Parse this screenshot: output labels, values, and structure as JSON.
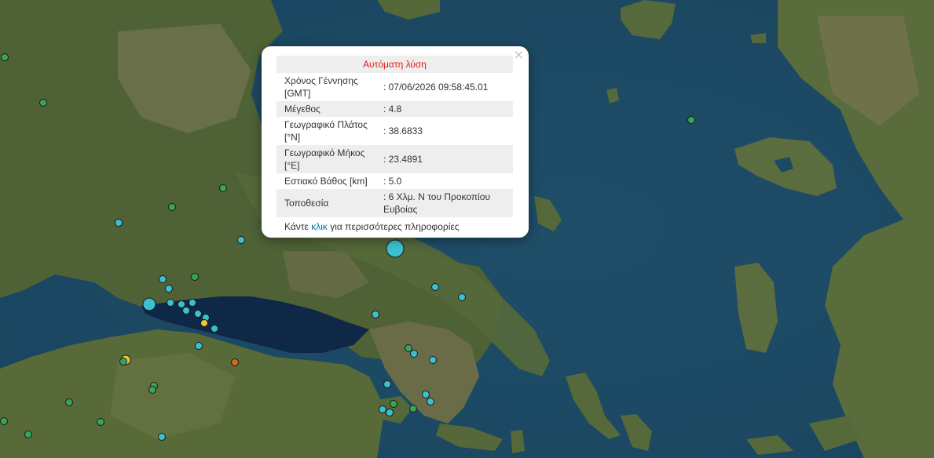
{
  "popup": {
    "title": "Αυτόματη λύση",
    "close_symbol": "×",
    "rows": [
      {
        "label": "Χρόνος Γέννησης [GMT]",
        "value": ": 07/06/2026 09:58:45.01"
      },
      {
        "label": "Μέγεθος",
        "value": ": 4.8"
      },
      {
        "label": "Γεωγραφικό Πλάτος [°N]",
        "value": ": 38.6833"
      },
      {
        "label": "Γεωγραφικό Μήκος [°E]",
        "value": ": 23.4891"
      },
      {
        "label": "Εστιακό Βάθος [km]",
        "value": ": 5.0"
      },
      {
        "label": "Τοποθεσία",
        "value": ": 6 Χλμ. Ν του Προκοπίου Ευβοίας"
      }
    ],
    "note_prefix": "Κάντε ",
    "note_link": "κλικ",
    "note_suffix": " για περισσότερες πληροφορίες"
  },
  "map": {
    "basemap": "satellite imagery",
    "colors": {
      "sea": "#1d4a63",
      "land": "#4a5e34",
      "gulf": "#0f2540",
      "marker_cyan": "#3cc0d0",
      "marker_green": "#3aa35a",
      "marker_yellow": "#e6c83a",
      "marker_orange": "#d2691e"
    }
  }
}
